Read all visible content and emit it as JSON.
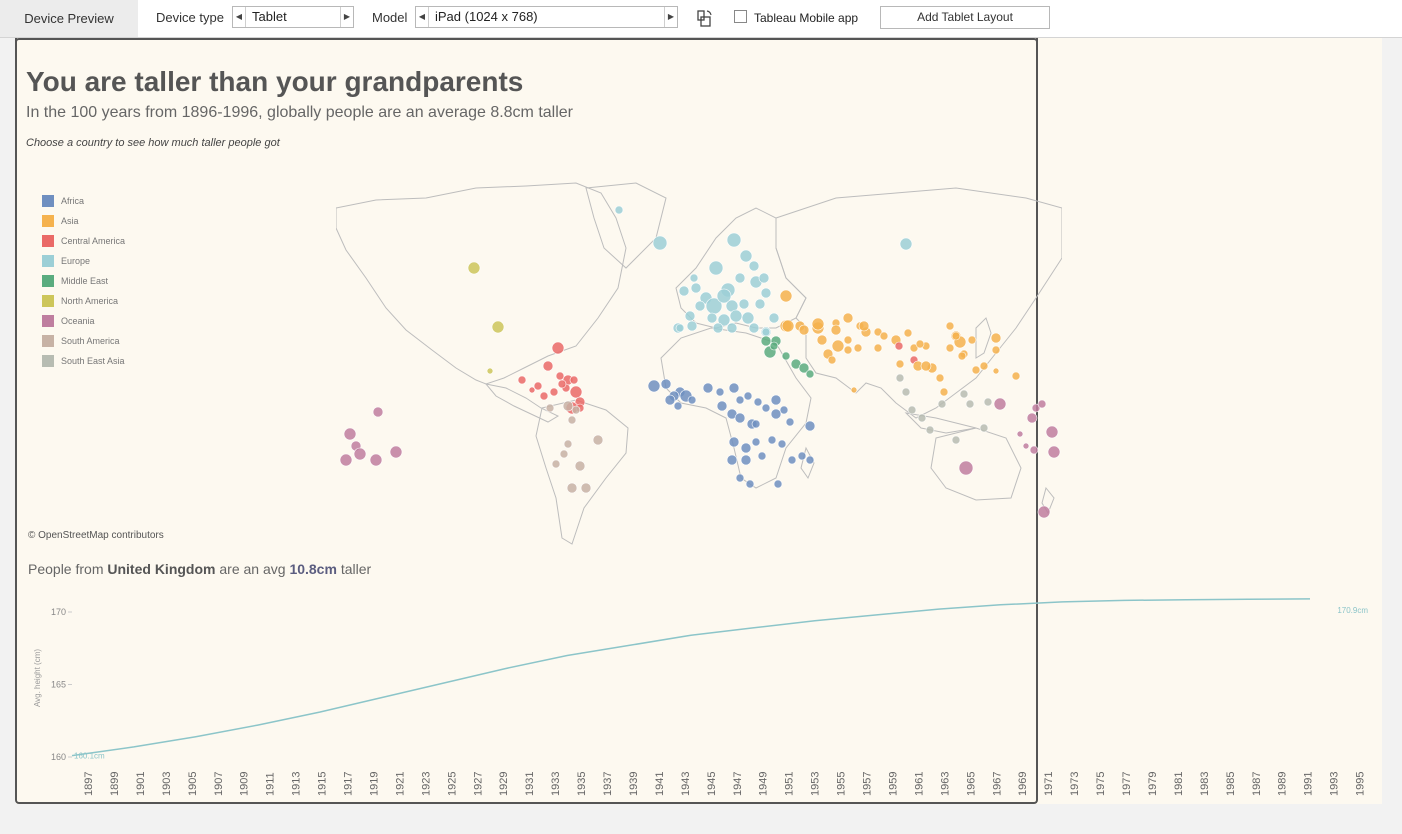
{
  "toolbar": {
    "title": "Device Preview",
    "device_type_label": "Device type",
    "device_type_value": "Tablet",
    "model_label": "Model",
    "model_value": "iPad (1024 x 768)",
    "mobile_app_label": "Tableau Mobile app",
    "add_layout_label": "Add Tablet Layout"
  },
  "dashboard": {
    "title": "You are taller than your grandparents",
    "subtitle": "In the 100 years from 1896-1996, globally people are an average 8.8cm taller",
    "instruction": "Choose a country to see how much taller people got",
    "attribution": "© OpenStreetMap contributors",
    "summary": {
      "prefix": "People from",
      "country": "United Kingdom",
      "middle": "are an avg",
      "value": "10.8cm",
      "suffix": "taller"
    }
  },
  "legend": [
    {
      "label": "Africa",
      "color": "#6f8fc0"
    },
    {
      "label": "Asia",
      "color": "#f5b24e"
    },
    {
      "label": "Central America",
      "color": "#ea6a67"
    },
    {
      "label": "Europe",
      "color": "#9ccfd6"
    },
    {
      "label": "Middle East",
      "color": "#5aac7f"
    },
    {
      "label": "North America",
      "color": "#cdc65a"
    },
    {
      "label": "Oceania",
      "color": "#bf7e9f"
    },
    {
      "label": "South America",
      "color": "#c7b2a5"
    },
    {
      "label": "South East Asia",
      "color": "#b7bcb2"
    }
  ],
  "chart_data": {
    "type": "line",
    "ylabel": "Avg. height (cm)",
    "ylim": [
      160,
      171
    ],
    "yticks": [
      160,
      165,
      170
    ],
    "x_tick_labels": [
      "1897",
      "1899",
      "1901",
      "1903",
      "1905",
      "1907",
      "1909",
      "1911",
      "1913",
      "1915",
      "1917",
      "1919",
      "1921",
      "1923",
      "1925",
      "1927",
      "1929",
      "1931",
      "1933",
      "1935",
      "1937",
      "1939",
      "1941",
      "1943",
      "1945",
      "1947",
      "1949",
      "1951",
      "1953",
      "1955",
      "1957",
      "1959",
      "1961",
      "1963",
      "1965",
      "1967",
      "1969",
      "1971",
      "1973",
      "1975",
      "1977",
      "1979",
      "1981",
      "1983",
      "1985",
      "1987",
      "1989",
      "1991",
      "1993",
      "1995"
    ],
    "series": [
      {
        "color": "#8cc5c9",
        "x": [
          1896,
          1901,
          1906,
          1911,
          1916,
          1921,
          1926,
          1931,
          1936,
          1941,
          1946,
          1951,
          1956,
          1961,
          1966,
          1971,
          1976,
          1981,
          1986,
          1991,
          1996
        ],
        "values": [
          160.1,
          160.7,
          161.4,
          162.2,
          163.1,
          164.1,
          165.1,
          166.1,
          167.0,
          167.7,
          168.4,
          168.9,
          169.4,
          169.8,
          170.2,
          170.5,
          170.7,
          170.8,
          170.85,
          170.88,
          170.9
        ],
        "start_label": "160.1cm",
        "end_label": "170.9cm"
      }
    ]
  }
}
